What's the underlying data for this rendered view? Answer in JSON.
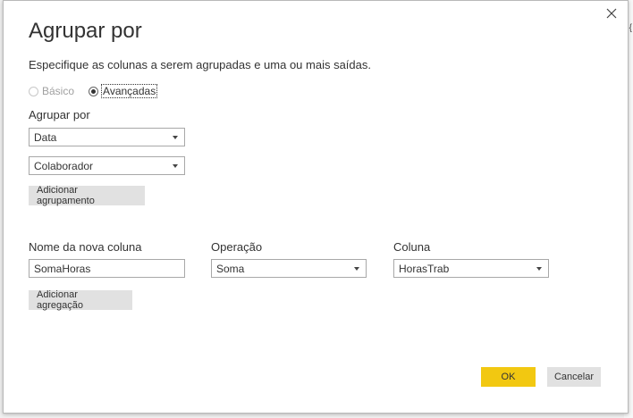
{
  "dialog": {
    "title": "Agrupar por",
    "subtitle": "Especifique as colunas a serem agrupadas e uma ou mais saídas.",
    "close_icon": "close-icon"
  },
  "mode": {
    "basic_label": "Básico",
    "advanced_label": "Avançadas",
    "selected": "Avançadas"
  },
  "group_by": {
    "label": "Agrupar por",
    "fields": [
      "Data",
      "Colaborador"
    ],
    "add_button": "Adicionar agrupamento"
  },
  "aggregation": {
    "new_column_label": "Nome da nova coluna",
    "operation_label": "Operação",
    "column_label": "Coluna",
    "new_column_value": "SomaHoras",
    "operation_value": "Soma",
    "column_value": "HorasTrab",
    "add_button": "Adicionar agregação"
  },
  "footer": {
    "ok_label": "OK",
    "cancel_label": "Cancelar"
  },
  "colors": {
    "primary_button": "#f2c811",
    "secondary_button": "#e1e1e1"
  }
}
